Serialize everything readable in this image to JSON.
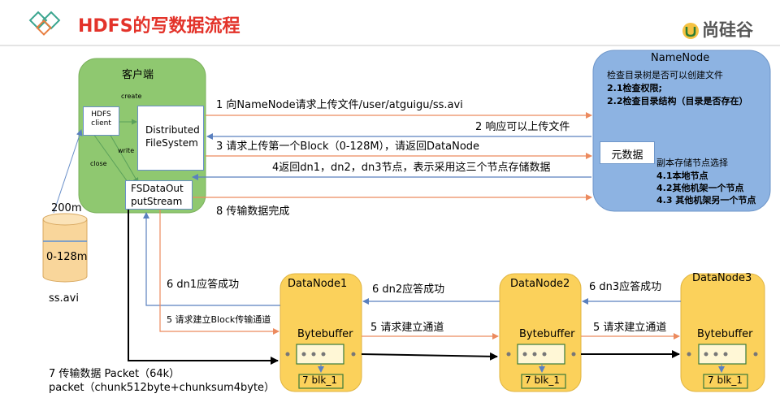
{
  "header": {
    "title": "HDFS的写数据流程",
    "brand": "尚硅谷"
  },
  "client": {
    "label": "客户端",
    "hdfs_client": "HDFS client",
    "dfs": "Distributed FileSystem",
    "fsdos": "FSDataOutputStream",
    "create": "create",
    "write": "write",
    "close": "close"
  },
  "file": {
    "size": "200m",
    "block": "0-128m",
    "name": "ss.avi"
  },
  "namenode": {
    "title": "NameNode",
    "check_title": "检查目录树是否可以创建文件",
    "check_1": "2.1检查权限;",
    "check_2": "2.2检查目录结构（目录是否存在）",
    "metadata": "元数据",
    "replica_title": "副本存储节点选择",
    "replica_1": "4.1本地节点",
    "replica_2": "4.2其他机架一个节点",
    "replica_3": "4.3 其他机架另一个节点"
  },
  "messages": {
    "m1": "1 向NameNode请求上传文件/user/atguigu/ss.avi",
    "m2": "2 响应可以上传文件",
    "m3": "3 请求上传第一个Block（0-128M），请返回DataNode",
    "m4": "4返回dn1，dn2，dn3节点，表示采用这三个节点存储数据",
    "m8": "8 传输数据完成",
    "m6_dn1": "6 dn1应答成功",
    "m5_client": "5 请求建立Block传输通道",
    "m6_dn2": "6 dn2应答成功",
    "m6_dn3": "6 dn3应答成功",
    "m5_dn1": "5 请求建立通道",
    "m5_dn2": "5 请求建立通道",
    "m7_line1": "7 传输数据 Packet（64k）",
    "m7_line2": "packet（chunk512byte+chunksum4byte）"
  },
  "datanodes": [
    {
      "name": "DataNode1",
      "buffer": "Bytebuffer",
      "blk": "7 blk_1"
    },
    {
      "name": "DataNode2",
      "buffer": "Bytebuffer",
      "blk": "7 blk_1"
    },
    {
      "name": "DataNode3",
      "buffer": "Bytebuffer",
      "blk": "7 blk_1"
    }
  ],
  "colors": {
    "title_red": "#e3332a",
    "client_green": "#8fc870",
    "namenode_blue": "#8db3e2",
    "datanode_yellow": "#fbd15b",
    "request_arrow": "#f4a582",
    "response_arrow": "#6a8fc9",
    "data_arrow": "#000000"
  }
}
